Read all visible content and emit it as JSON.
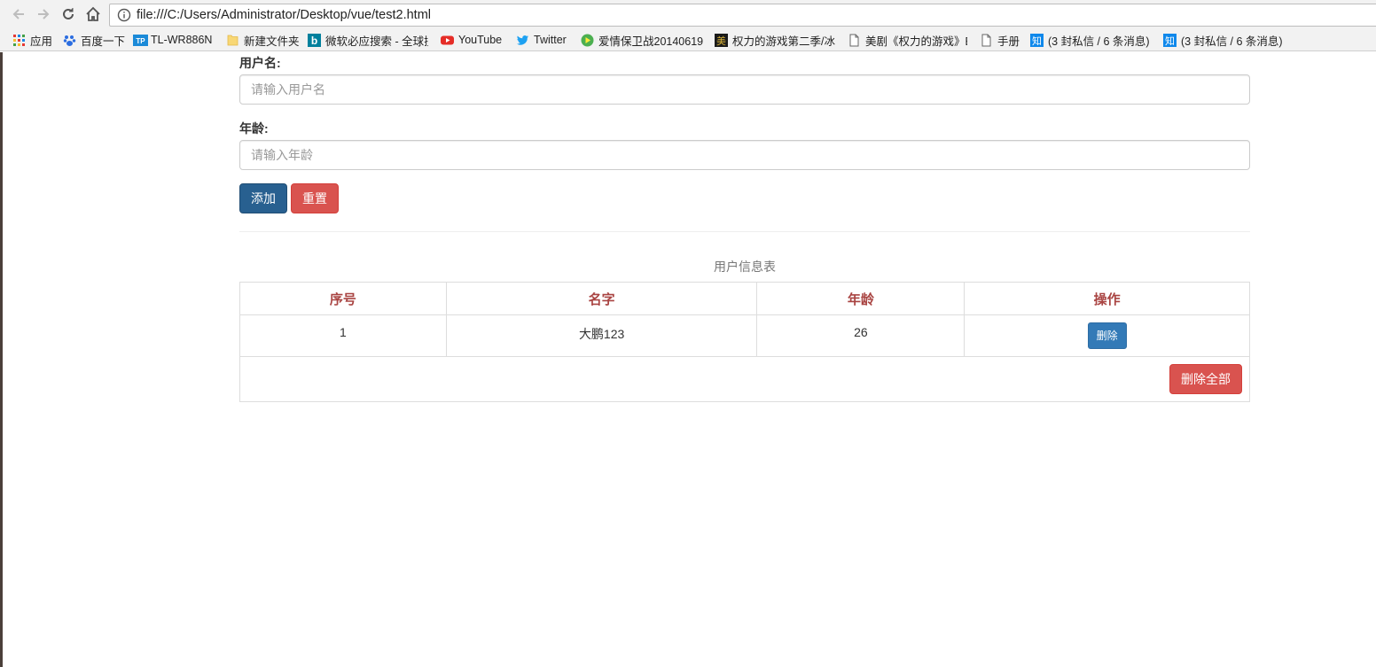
{
  "browser": {
    "url": "file:///C:/Users/Administrator/Desktop/vue/test2.html",
    "bookmarks": [
      {
        "label": "应用",
        "icon": "apps-grid-icon"
      },
      {
        "label": "百度一下",
        "icon": "baidu-paw-icon"
      },
      {
        "label": "TL-WR886N",
        "icon": "tp-link-icon"
      },
      {
        "label": "新建文件夹",
        "icon": "folder-icon"
      },
      {
        "label": "微软必应搜索 - 全球搜",
        "icon": "bing-icon"
      },
      {
        "label": "YouTube",
        "icon": "youtube-icon"
      },
      {
        "label": "Twitter",
        "icon": "twitter-icon"
      },
      {
        "label": "爱情保卫战20140619",
        "icon": "play-icon"
      },
      {
        "label": "权力的游戏第二季/冰",
        "icon": "site-icon"
      },
      {
        "label": "美剧《权力的游戏》B",
        "icon": "page-icon"
      },
      {
        "label": "手册",
        "icon": "page-icon"
      },
      {
        "label": "(3 封私信 / 6 条消息)",
        "icon": "zhihu-icon"
      },
      {
        "label": "(3 封私信 / 6 条消息)",
        "icon": "zhihu-icon"
      }
    ]
  },
  "form": {
    "username_label": "用户名:",
    "username_placeholder": "请输入用户名",
    "username_value": "",
    "age_label": "年龄:",
    "age_placeholder": "请输入年龄",
    "age_value": "",
    "add_button": "添加",
    "reset_button": "重置"
  },
  "table": {
    "caption": "用户信息表",
    "headers": [
      "序号",
      "名字",
      "年龄",
      "操作"
    ],
    "rows": [
      {
        "index": "1",
        "name": "大鹏123",
        "age": "26",
        "action": "删除"
      }
    ],
    "delete_all_button": "删除全部"
  },
  "colors": {
    "header_text": "#a94442",
    "primary": "#337ab7",
    "primary_active": "#286090",
    "danger": "#d9534f"
  }
}
